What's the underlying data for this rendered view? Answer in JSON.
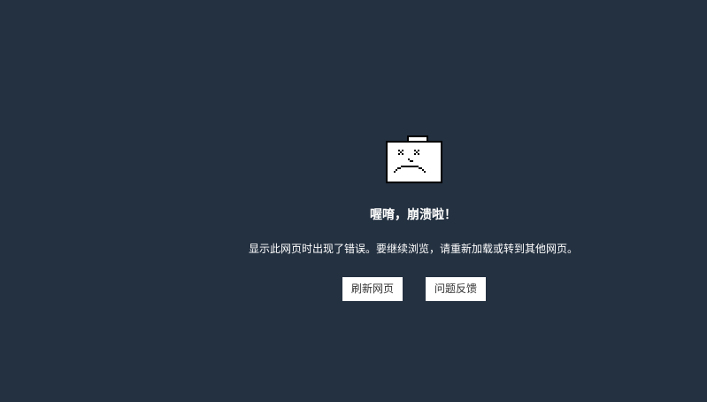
{
  "error": {
    "title": "喔唷，崩溃啦！",
    "message": "显示此网页时出现了错误。要继续浏览，请重新加载或转到其他网页。"
  },
  "buttons": {
    "reload": "刷新网页",
    "feedback": "问题反馈"
  },
  "icon": {
    "name": "sad-folder-icon"
  },
  "colors": {
    "background": "#243141",
    "text": "#ffffff",
    "button_bg": "#ffffff",
    "button_text": "#333333"
  }
}
